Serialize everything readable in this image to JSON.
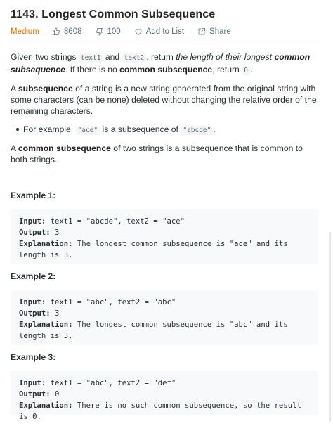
{
  "problem": {
    "title": "1143. Longest Common Subsequence",
    "difficulty": "Medium",
    "likes": "8608",
    "dislikes": "100",
    "add_to_list": "Add to List",
    "share": "Share"
  },
  "description": {
    "p1": {
      "t1": "Given two strings ",
      "code1": "text1",
      "t2": " and ",
      "code2": "text2",
      "t3": ", return ",
      "em1": "the length of their longest ",
      "em_strong": "common subsequence",
      "t4": ". If there is no ",
      "strong1": "common subsequence",
      "t5": ", return ",
      "code3": "0",
      "t6": "."
    },
    "p2": {
      "t1": "A ",
      "strong1": "subsequence",
      "t2": " of a string is a new string generated from the original string with some characters (can be none) deleted without changing the relative order of the remaining characters."
    },
    "bullet": {
      "t1": "For example, ",
      "code1": "\"ace\"",
      "t2": " is a subsequence of ",
      "code2": "\"abcde\"",
      "t3": "."
    },
    "p3": {
      "t1": "A ",
      "strong1": "common subsequence",
      "t2": " of two strings is a subsequence that is common to both strings."
    }
  },
  "examples": [
    {
      "heading": "Example 1:",
      "input_label": "Input:",
      "input": " text1 = \"abcde\", text2 = \"ace\"",
      "output_label": "Output:",
      "output": " 3",
      "explanation_label": "Explanation:",
      "explanation": " The longest common subsequence is \"ace\" and its length is 3."
    },
    {
      "heading": "Example 2:",
      "input_label": "Input:",
      "input": " text1 = \"abc\", text2 = \"abc\"",
      "output_label": "Output:",
      "output": " 3",
      "explanation_label": "Explanation:",
      "explanation": " The longest common subsequence is \"abc\" and its length is 3."
    },
    {
      "heading": "Example 3:",
      "input_label": "Input:",
      "input": " text1 = \"abc\", text2 = \"def\"",
      "output_label": "Output:",
      "output": " 0",
      "explanation_label": "Explanation:",
      "explanation": " There is no such common subsequence, so the result is 0."
    }
  ]
}
